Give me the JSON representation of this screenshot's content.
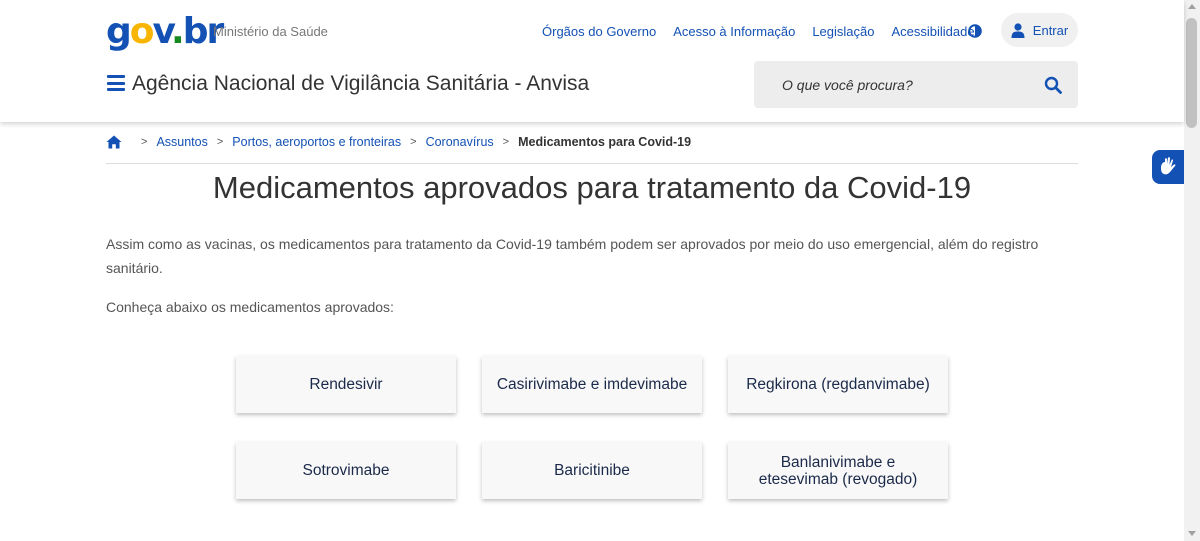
{
  "header": {
    "logo": {
      "g": "g",
      "o": "o",
      "v": "v",
      "dot": ".",
      "b": "b",
      "r": "r"
    },
    "ministry": "Ministério da Saúde",
    "links": [
      "Órgãos do Governo",
      "Acesso à Informação",
      "Legislação",
      "Acessibilidade"
    ],
    "login_label": "Entrar",
    "site_title": "Agência Nacional de Vigilância Sanitária - Anvisa",
    "search_placeholder": "O que você procura?"
  },
  "icons": {
    "contrast": "contrast-icon",
    "user": "user-icon",
    "menu": "hamburger-menu-icon",
    "search": "search-icon",
    "home": "home-icon",
    "accessibility": "sign-language-icon"
  },
  "breadcrumb": {
    "items": [
      "Assuntos",
      "Portos, aeroportos e fronteiras",
      "Coronavírus"
    ],
    "separator": ">",
    "current": "Medicamentos para Covid-19"
  },
  "main": {
    "title": "Medicamentos aprovados para tratamento da Covid-19",
    "intro": "Assim como as vacinas, os medicamentos para tratamento da Covid-19 também podem ser aprovados por meio do uso emergencial, além do registro sanitário.",
    "intro2": "Conheça abaixo os medicamentos aprovados:",
    "cards": [
      "Rendesivir",
      "Casirivimabe e imdevimabe",
      "Regkirona (regdanvimabe)",
      "Sotrovimabe",
      "Baricitinibe",
      "Banlanivimabe e etesevimab (revogado)"
    ]
  },
  "colors": {
    "primary": "#1351b4",
    "logo_yellow": "#f7b500",
    "logo_green": "#168821",
    "card_bg": "#f8f8f8",
    "search_bg": "#ededed"
  }
}
